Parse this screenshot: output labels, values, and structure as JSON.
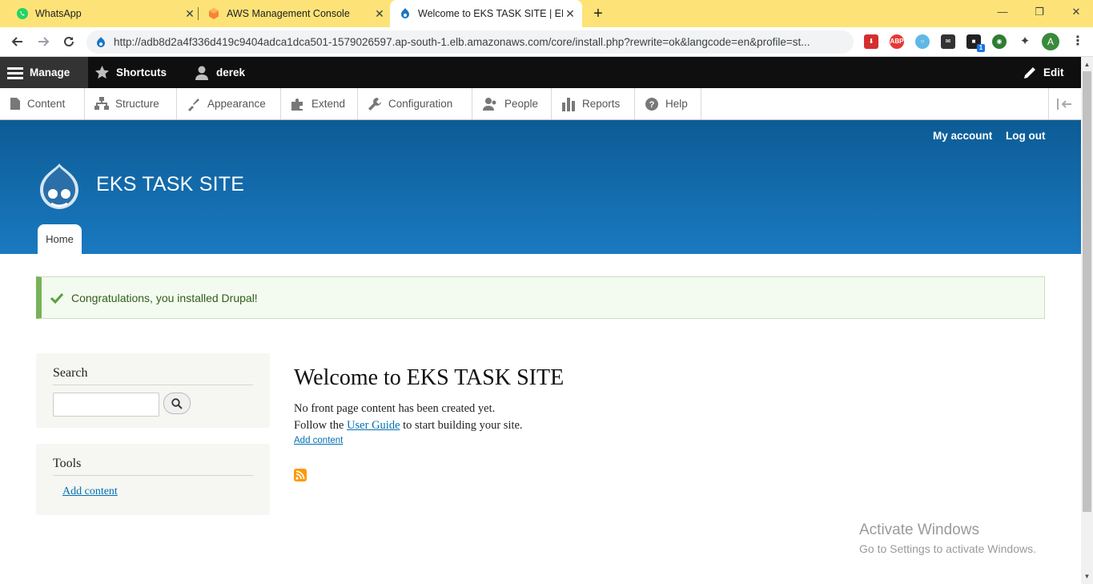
{
  "browser": {
    "tabs": [
      {
        "title": "WhatsApp",
        "icon": "whatsapp-icon",
        "active": false
      },
      {
        "title": "AWS Management Console",
        "icon": "aws-icon",
        "active": false
      },
      {
        "title": "Welcome to EKS TASK SITE | EKS",
        "icon": "drupal-icon",
        "active": true
      }
    ],
    "new_tab": "+",
    "url": "http://adb8d2a4f336d419c9404adca1dca501-1579026597.ap-south-1.elb.amazonaws.com/core/install.php?rewrite=ok&langcode=en&profile=st...",
    "profile_initial": "A",
    "extensions": [
      "download-ext-icon",
      "adblock-ext-icon",
      "search-ext-icon",
      "mail-ext-icon",
      "cube-ext-icon",
      "globe-ext-icon",
      "puzzle-icon"
    ],
    "extension_labels": {
      "abp": "ABP",
      "badge": "1"
    },
    "window_controls": {
      "minimize": "—",
      "restore": "❐",
      "close": "✕"
    }
  },
  "admin_toolbar": {
    "manage": "Manage",
    "shortcuts": "Shortcuts",
    "user": "derek",
    "edit": "Edit"
  },
  "admin_tray": {
    "items": [
      "Content",
      "Structure",
      "Appearance",
      "Extend",
      "Configuration",
      "People",
      "Reports",
      "Help"
    ]
  },
  "site": {
    "name": "EKS TASK SITE",
    "secondary_menu": [
      "My account",
      "Log out"
    ],
    "main_menu": [
      "Home"
    ]
  },
  "message": {
    "text": "Congratulations, you installed Drupal!"
  },
  "sidebar": {
    "search": {
      "title": "Search",
      "value": ""
    },
    "tools": {
      "title": "Tools",
      "links": [
        "Add content"
      ]
    }
  },
  "main": {
    "title": "Welcome to EKS TASK SITE",
    "line1": "No front page content has been created yet.",
    "line2_prefix": "Follow the ",
    "line2_link": "User Guide",
    "line2_suffix": " to start building your site.",
    "add_content": "Add content"
  },
  "watermark": {
    "line1": "Activate Windows",
    "line2": "Go to Settings to activate Windows."
  },
  "colors": {
    "tabstrip": "#fde377",
    "header_top": "#0c5c95",
    "header_bottom": "#1a79c0",
    "link": "#0071b3",
    "status_green": "#77b259"
  }
}
